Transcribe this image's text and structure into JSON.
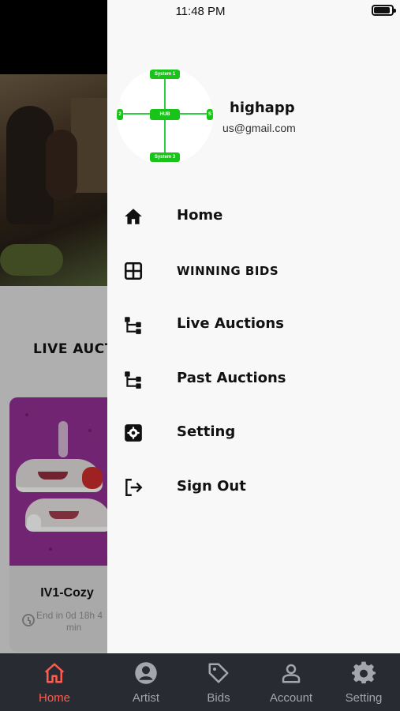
{
  "status_bar": {
    "time": "11:48 PM"
  },
  "background": {
    "section_title": "LIVE AUCTI",
    "card": {
      "name": "IV1-Cozy",
      "end_text": "End in 0d 18h 4",
      "end_unit": "min"
    }
  },
  "drawer": {
    "avatar": {
      "top": "System 1",
      "hub": "HUB",
      "bottom": "System 3",
      "left": "2",
      "right": "S"
    },
    "user": {
      "name": "highapp",
      "email": "us@gmail.com"
    },
    "menu": [
      {
        "label": "Home",
        "icon": "home-icon"
      },
      {
        "label": "WINNING BIDS",
        "icon": "grid-icon"
      },
      {
        "label": "Live Auctions",
        "icon": "tree-icon"
      },
      {
        "label": "Past Auctions",
        "icon": "tree-icon"
      },
      {
        "label": "Setting",
        "icon": "gear-icon"
      },
      {
        "label": "Sign Out",
        "icon": "logout-icon"
      }
    ]
  },
  "bottom_nav": {
    "active_color": "#ff5c4d",
    "inactive_color": "#a3a6ad",
    "items": [
      {
        "label": "Home",
        "icon": "home-icon",
        "active": true
      },
      {
        "label": "Artist",
        "icon": "person-circle-icon",
        "active": false
      },
      {
        "label": "Bids",
        "icon": "tag-icon",
        "active": false
      },
      {
        "label": "Account",
        "icon": "account-icon",
        "active": false
      },
      {
        "label": "Setting",
        "icon": "gear-icon",
        "active": false
      }
    ]
  }
}
